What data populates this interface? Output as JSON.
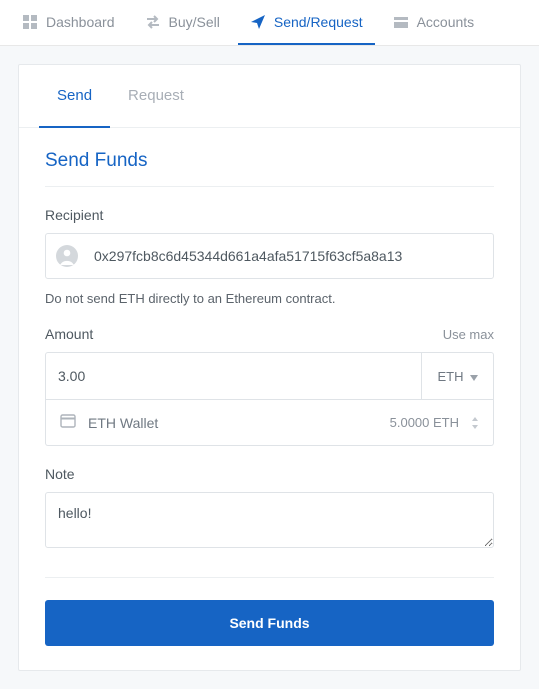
{
  "nav": {
    "items": [
      {
        "label": "Dashboard"
      },
      {
        "label": "Buy/Sell"
      },
      {
        "label": "Send/Request"
      },
      {
        "label": "Accounts"
      }
    ]
  },
  "tabs": {
    "send": "Send",
    "request": "Request"
  },
  "section_title": "Send Funds",
  "recipient": {
    "label": "Recipient",
    "value": "0x297fcb8c6d45344d661a4afa51715f63cf5a8a13",
    "warning": "Do not send ETH directly to an Ethereum contract."
  },
  "amount": {
    "label": "Amount",
    "use_max": "Use max",
    "value": "3.00",
    "currency": "ETH",
    "wallet_name": "ETH Wallet",
    "wallet_balance": "5.0000 ETH"
  },
  "note": {
    "label": "Note",
    "value": "hello!"
  },
  "submit_label": "Send Funds"
}
